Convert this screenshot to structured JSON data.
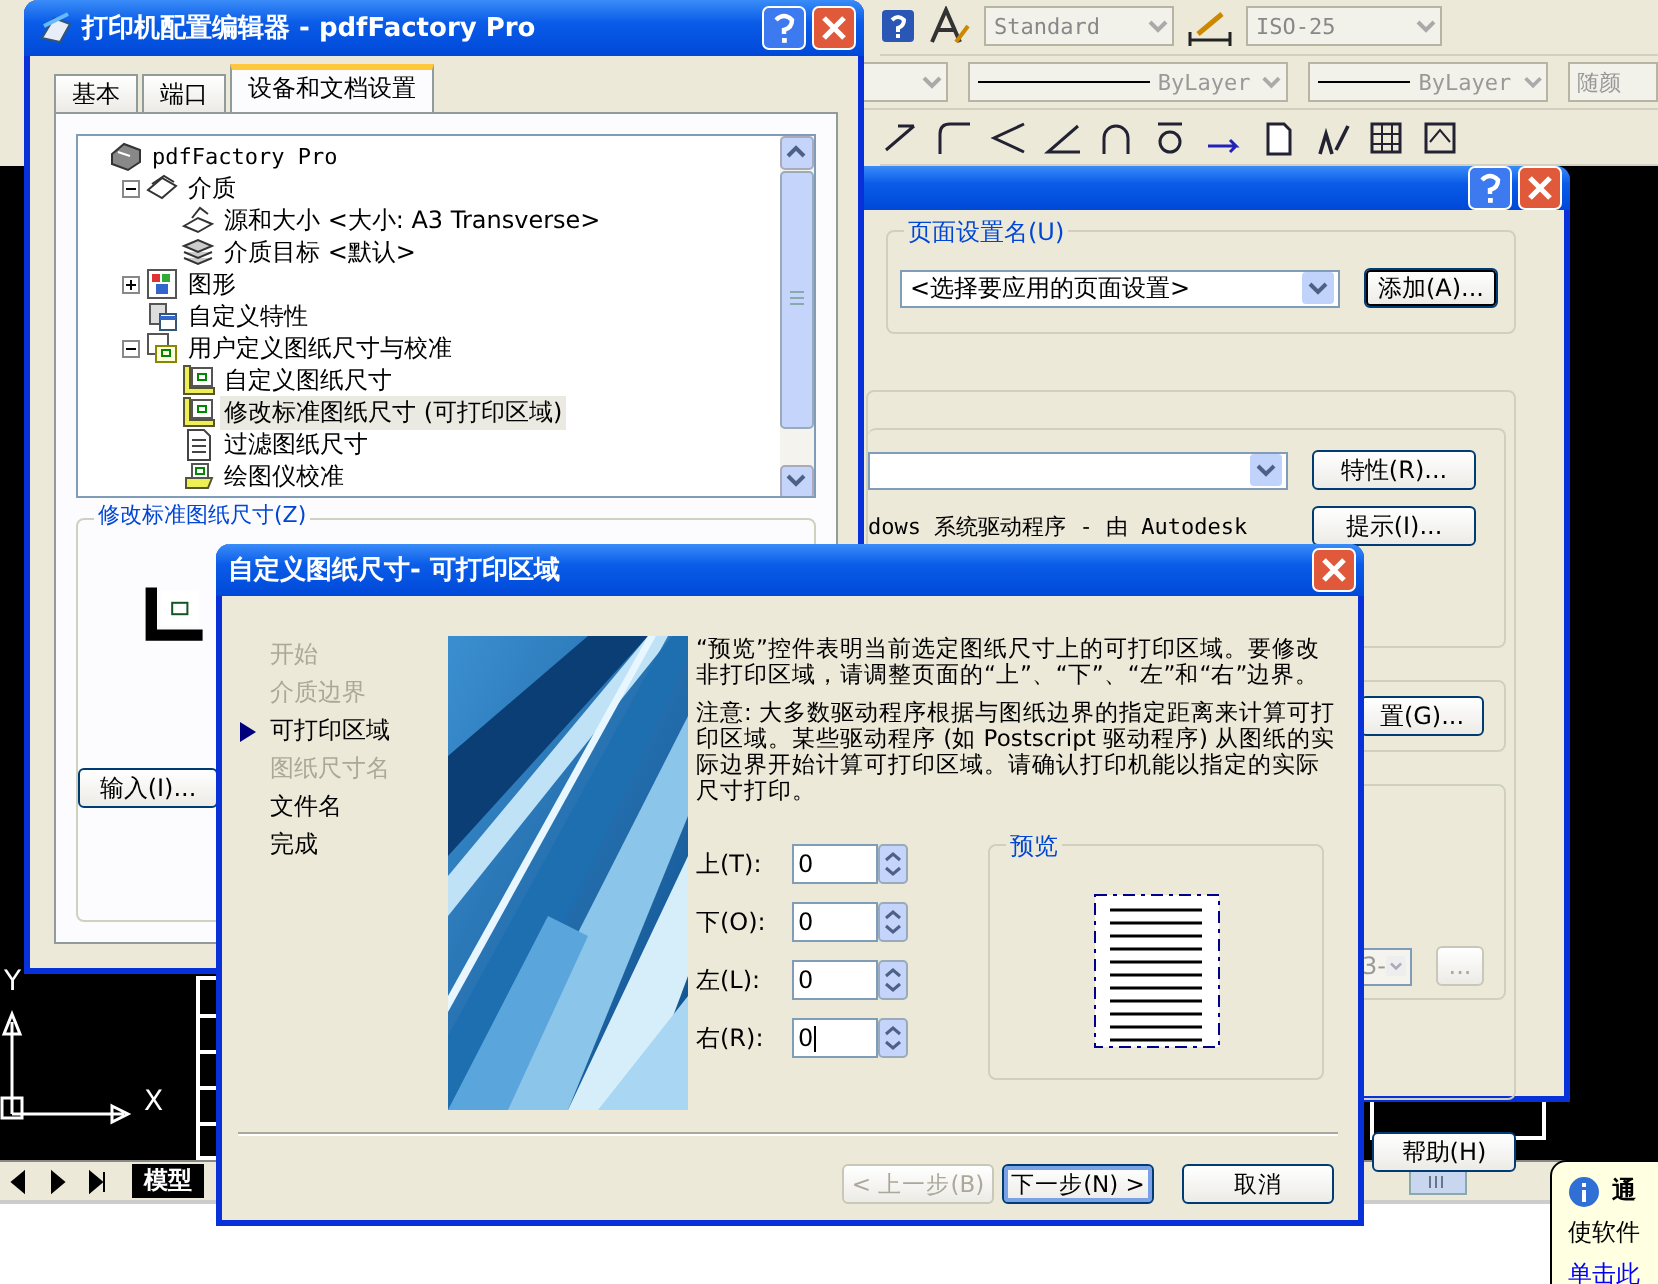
{
  "cad": {
    "toolbar_1": {
      "text_style": "Standard",
      "dim_style": "ISO-25"
    },
    "toolbar_2": {
      "combos": [
        "ByLayer",
        "ByLayer",
        "随颜"
      ]
    },
    "axis_labels": [
      "Y",
      "X"
    ],
    "layout_tab": "模型"
  },
  "page_setup": {
    "group_label": "页面设置名(U)",
    "page_setup_select": "<选择要应用的页面设置>",
    "add_button": "添加(A)...",
    "properties_button": "特性(R)...",
    "driver_text": "dows 系统驱动程序 - 由 Autodesk",
    "hint_button": "提示(I)...",
    "settings_button": "置(G)...",
    "size_select": "3-",
    "more_button": "...",
    "help_button": "帮助(H)"
  },
  "printer_editor": {
    "title": "打印机配置编辑器 - pdfFactory Pro",
    "tabs": [
      {
        "label": "基本",
        "selected": false
      },
      {
        "label": "端口",
        "selected": false
      },
      {
        "label": "设备和文档设置",
        "selected": true
      }
    ],
    "tree": [
      {
        "label": "pdfFactory Pro",
        "kind": "printer",
        "selected": false,
        "children": [
          {
            "label": "介质",
            "kind": "media",
            "selected": false,
            "expanded": true,
            "children": [
              {
                "label": "源和大小 <大小: A3 Transverse>",
                "kind": "tray",
                "selected": false
              },
              {
                "label": "介质目标 <默认>",
                "kind": "stack",
                "selected": false
              }
            ]
          },
          {
            "label": "图形",
            "kind": "graphics",
            "selected": false,
            "expanded": false
          },
          {
            "label": "自定义特性",
            "kind": "custom",
            "selected": false
          },
          {
            "label": "用户定义图纸尺寸与校准",
            "kind": "sheet",
            "selected": false,
            "expanded": true,
            "children": [
              {
                "label": "自定义图纸尺寸",
                "kind": "ruler",
                "selected": false
              },
              {
                "label": "修改标准图纸尺寸 (可打印区域)",
                "kind": "ruler",
                "selected": true
              },
              {
                "label": "过滤图纸尺寸",
                "kind": "document",
                "selected": false
              },
              {
                "label": "绘图仪校准",
                "kind": "plotter",
                "selected": false
              }
            ]
          }
        ]
      }
    ],
    "group_label": "修改标准图纸尺寸(Z)",
    "import_button": "输入(I)..."
  },
  "wizard": {
    "title": "自定义图纸尺寸- 可打印区域",
    "steps": [
      {
        "label": "开始",
        "selected": false,
        "disabled": true
      },
      {
        "label": "介质边界",
        "selected": false,
        "disabled": true
      },
      {
        "label": "可打印区域",
        "selected": true,
        "disabled": false
      },
      {
        "label": "图纸尺寸名",
        "selected": false,
        "disabled": true
      },
      {
        "label": "文件名",
        "selected": false,
        "disabled": false
      },
      {
        "label": "完成",
        "selected": false,
        "disabled": false
      }
    ],
    "paragraphs": [
      "“预览”控件表明当前选定图纸尺寸上的可打印区域。要修改非打印区域，请调整页面的“上”、“下”、“左”和“右”边界。",
      "注意: 大多数驱动程序根据与图纸边界的指定距离来计算可打印区域。某些驱动程序 (如 Postscript 驱动程序) 从图纸的实际边界开始计算可打印区域。请确认打印机能以指定的实际尺寸打印。"
    ],
    "margins": [
      {
        "label": "上(T):",
        "value": "0",
        "focused": false
      },
      {
        "label": "下(O):",
        "value": "0",
        "focused": false
      },
      {
        "label": "左(L):",
        "value": "0",
        "focused": false
      },
      {
        "label": "右(R):",
        "value": "0",
        "focused": true
      }
    ],
    "preview_label": "预览",
    "buttons": [
      {
        "label": "< 上一步(B)",
        "disabled": true,
        "default": false
      },
      {
        "label": "下一步(N) >",
        "disabled": false,
        "default": true
      },
      {
        "label": "取消",
        "disabled": false,
        "default": false
      }
    ]
  },
  "notification": {
    "title": "通",
    "text": "使软件",
    "link": "单击此"
  }
}
